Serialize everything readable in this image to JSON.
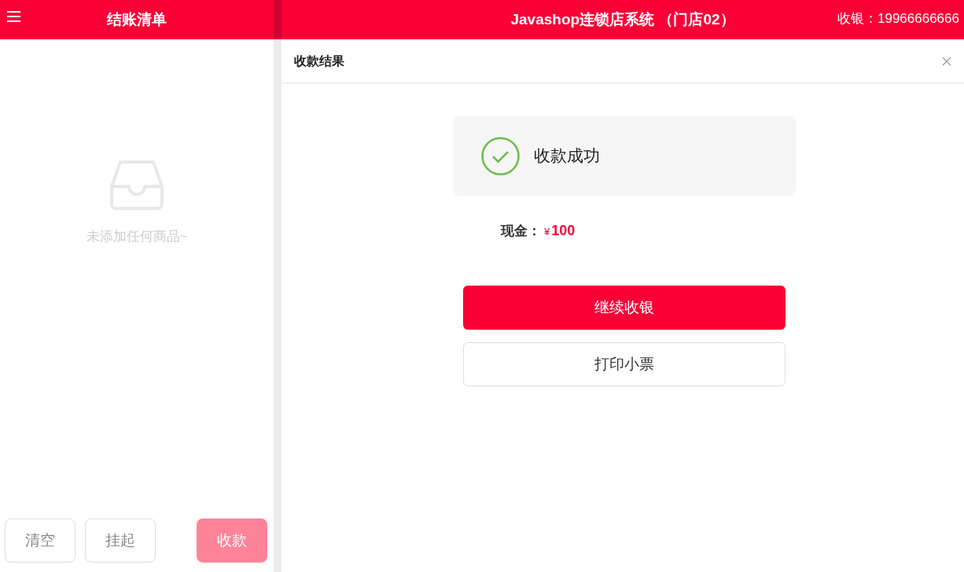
{
  "cart_panel": {
    "title": "结账清单",
    "empty_message": "未添加任何商品~",
    "buttons": [
      {
        "label": "清空",
        "kind": "outline",
        "disabled": false
      },
      {
        "label": "挂起",
        "kind": "outline",
        "disabled": false
      },
      {
        "label": "收款",
        "kind": "primary",
        "disabled": true
      }
    ]
  },
  "app_header": {
    "title": "Javashop连锁店系统 （门店02）",
    "cashier": "收银：19966666666"
  },
  "dialog": {
    "title": "收款结果",
    "result": "收款成功",
    "payments": [
      {
        "label": "现金：",
        "currency": "¥",
        "amount": "100"
      }
    ],
    "buttons": [
      {
        "label": "继续收银",
        "kind": "primary"
      },
      {
        "label": "打印小票",
        "kind": "outline"
      }
    ]
  }
}
